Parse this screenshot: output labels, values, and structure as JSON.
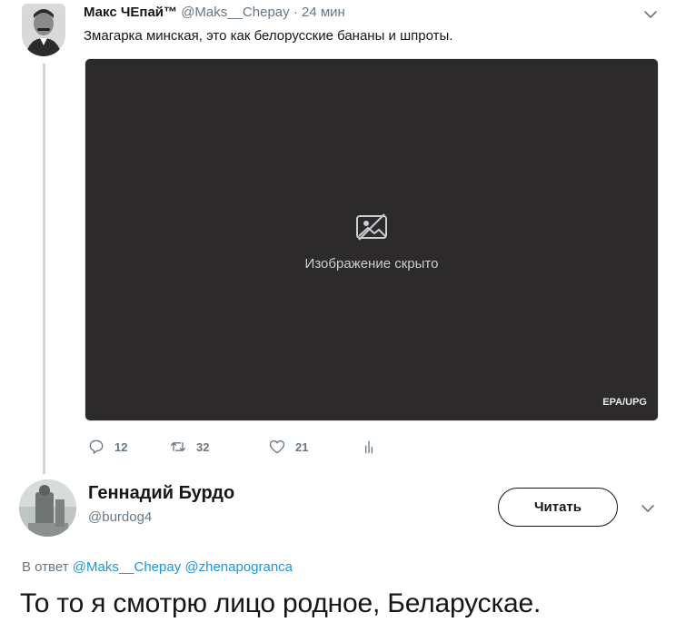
{
  "tweet1": {
    "name": "Макс ЧЕпай™",
    "handle": "@Maks__Chepay",
    "separator": "·",
    "time": "24 мин",
    "text": "Змагарка минская, это как белорусские бананы и шпроты.",
    "avatar_icon": "user-avatar",
    "media": {
      "credit": "EPA/UPG",
      "notice": "Изображение скрыто"
    },
    "actions": {
      "reply_count": "12",
      "retweet_count": "32",
      "like_count": "21"
    }
  },
  "tweet2": {
    "name": "Геннадий Бурдо",
    "handle": "@burdog4",
    "follow_label": "Читать",
    "reply_prefix": "В ответ",
    "reply_users": [
      "@Maks__Chepay",
      "@zhenapogranca"
    ],
    "text": "То то я смотрю лицо родное, Беларускае."
  },
  "colors": {
    "secondary_text": "#657786",
    "link": "#1b95e0",
    "thread_line": "#ccd6dd"
  }
}
